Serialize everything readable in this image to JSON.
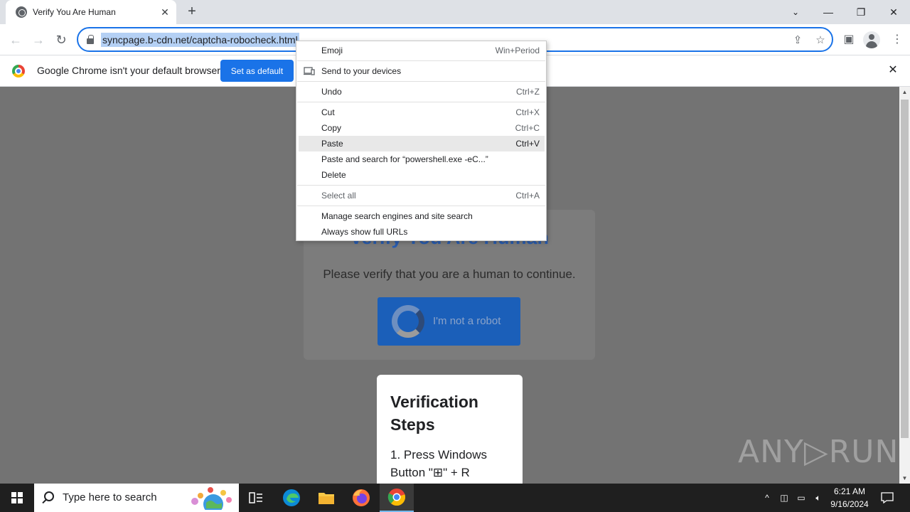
{
  "browser": {
    "tab": {
      "title": "Verify You Are Human"
    },
    "url": "syncpage.b-cdn.net/captcha-robocheck.html",
    "window_controls": {
      "minimize": "—",
      "restore": "❐",
      "close": "✕"
    }
  },
  "infobar": {
    "message": "Google Chrome isn't your default browser",
    "button": "Set as default"
  },
  "context_menu": {
    "items": [
      {
        "label": "Emoji",
        "shortcut": "Win+Period"
      },
      {
        "label": "Send to your devices",
        "shortcut": ""
      },
      {
        "label": "Undo",
        "shortcut": "Ctrl+Z"
      },
      {
        "label": "Cut",
        "shortcut": "Ctrl+X"
      },
      {
        "label": "Copy",
        "shortcut": "Ctrl+C"
      },
      {
        "label": "Paste",
        "shortcut": "Ctrl+V"
      },
      {
        "label": "Paste and search for “powershell.exe -eC...”",
        "shortcut": ""
      },
      {
        "label": "Delete",
        "shortcut": ""
      },
      {
        "label": "Select all",
        "shortcut": "Ctrl+A"
      },
      {
        "label": "Manage search engines and site search",
        "shortcut": ""
      },
      {
        "label": "Always show full URLs",
        "shortcut": ""
      }
    ]
  },
  "page": {
    "heading": "Verify You Are Human",
    "subtitle": "Please verify that you are a human to continue.",
    "robot_button": "I'm not a robot",
    "steps_title": "Verification Steps",
    "step1": "1. Press Windows Button \"⊞\" + R"
  },
  "watermark": "ANY▷RUN",
  "taskbar": {
    "search_placeholder": "Type here to search",
    "time": "6:21 AM",
    "date": "9/16/2024"
  },
  "colors": {
    "accent": "#1a73e8",
    "page_overlay": "#737373",
    "captcha_heading": "#2a5db0",
    "captcha_button": "#1b5fb9"
  }
}
